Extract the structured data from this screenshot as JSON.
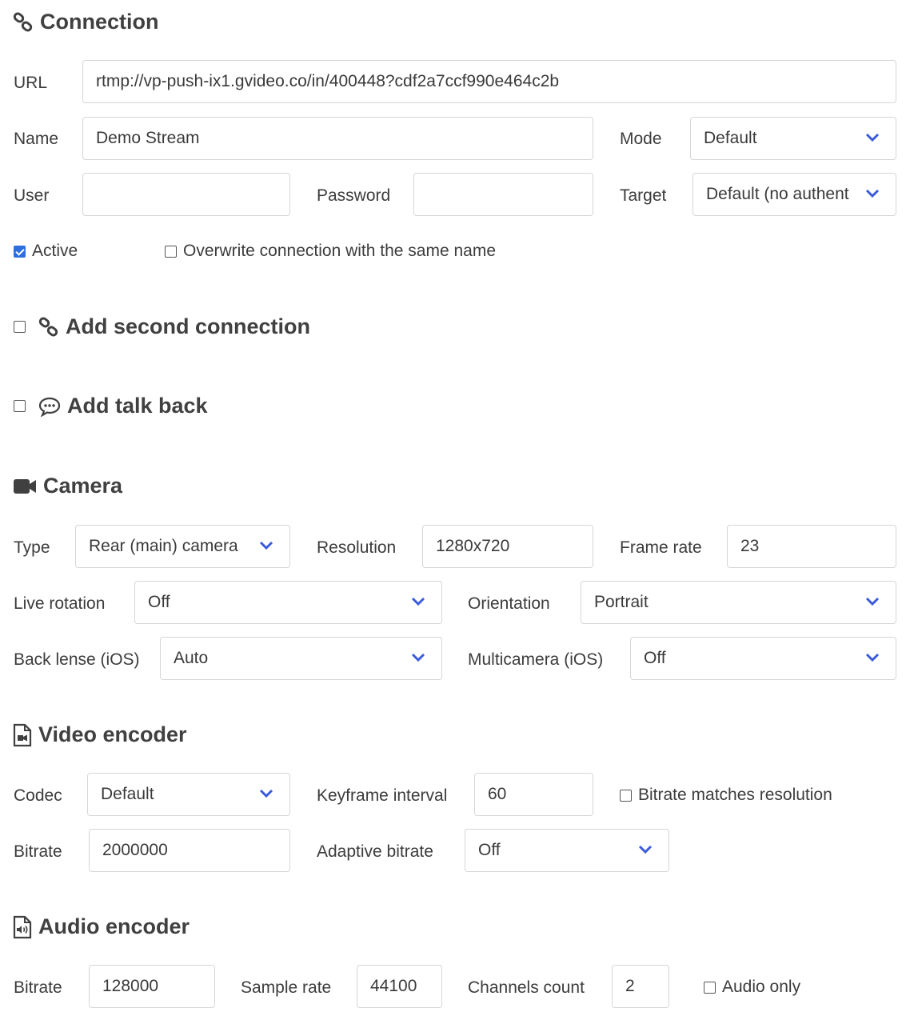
{
  "colors": {
    "accent": "#2d6fdc",
    "chevron": "#3b5bdb",
    "text": "#333333",
    "border": "#d6d6d6"
  },
  "connection": {
    "heading": "Connection",
    "icon": "link-icon",
    "url_label": "URL",
    "url_value": "rtmp://vp-push-ix1.gvideo.co/in/400448?cdf2a7ccf990e464c2b",
    "name_label": "Name",
    "name_value": "Demo Stream",
    "mode_label": "Mode",
    "mode_value": "Default",
    "user_label": "User",
    "user_value": "",
    "password_label": "Password",
    "password_value": "",
    "target_label": "Target",
    "target_value": "Default (no authent",
    "active_label": "Active",
    "active_checked": true,
    "overwrite_label": "Overwrite connection with the same name",
    "overwrite_checked": false
  },
  "second_connection": {
    "heading": "Add second connection",
    "icon": "link-icon",
    "checked": false
  },
  "talk_back": {
    "heading": "Add talk back",
    "icon": "speech-bubble-icon",
    "checked": false
  },
  "camera": {
    "heading": "Camera",
    "icon": "video-camera-icon",
    "type_label": "Type",
    "type_value": "Rear (main) camera",
    "resolution_label": "Resolution",
    "resolution_value": "1280x720",
    "frame_rate_label": "Frame rate",
    "frame_rate_value": "23",
    "live_rotation_label": "Live rotation",
    "live_rotation_value": "Off",
    "orientation_label": "Orientation",
    "orientation_value": "Portrait",
    "back_lense_label": "Back lense (iOS)",
    "back_lense_value": "Auto",
    "multicamera_label": "Multicamera (iOS)",
    "multicamera_value": "Off"
  },
  "video_encoder": {
    "heading": "Video encoder",
    "icon": "video-file-icon",
    "codec_label": "Codec",
    "codec_value": "Default",
    "keyframe_label": "Keyframe interval",
    "keyframe_value": "60",
    "bitrate_matches_label": "Bitrate matches resolution",
    "bitrate_matches_checked": false,
    "bitrate_label": "Bitrate",
    "bitrate_value": "2000000",
    "adaptive_label": "Adaptive bitrate",
    "adaptive_value": "Off"
  },
  "audio_encoder": {
    "heading": "Audio encoder",
    "icon": "audio-file-icon",
    "bitrate_label": "Bitrate",
    "bitrate_value": "128000",
    "sample_rate_label": "Sample rate",
    "sample_rate_value": "44100",
    "channels_label": "Channels count",
    "channels_value": "2",
    "audio_only_label": "Audio only",
    "audio_only_checked": false
  }
}
